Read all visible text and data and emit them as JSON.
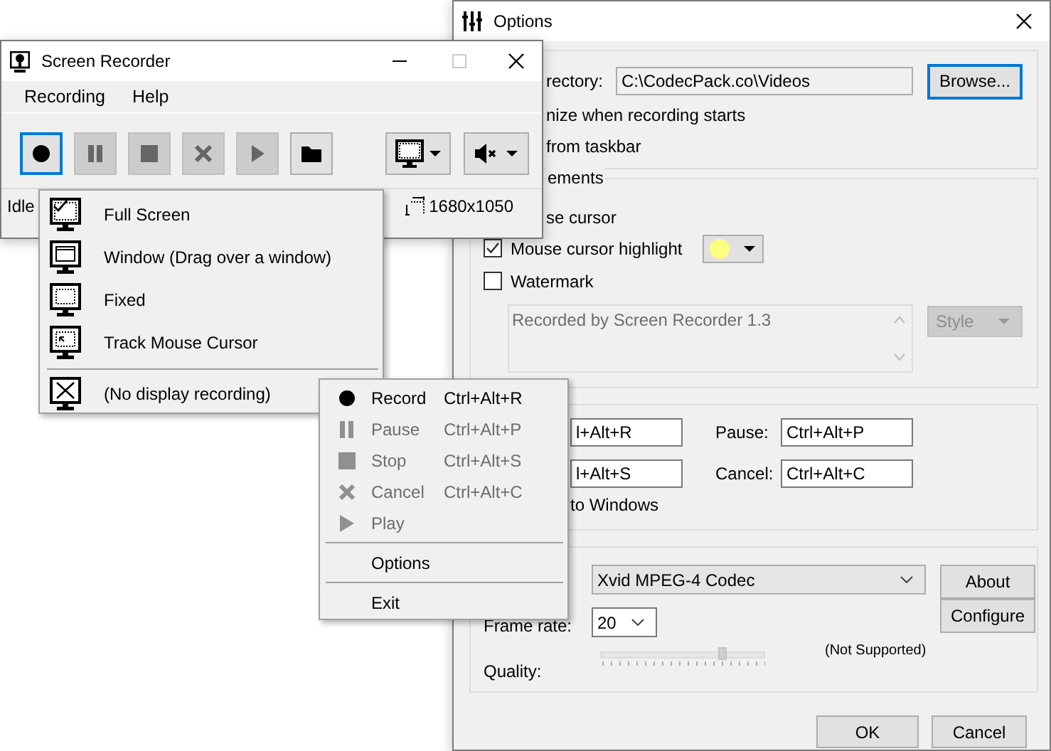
{
  "options_window": {
    "title": "Options",
    "general": {
      "directory_label": "rectory:",
      "directory": "C:\\CodecPack.co\\Videos",
      "browse": "Browse...",
      "lines": [
        "nize when recording starts",
        "from taskbar"
      ]
    },
    "elements": {
      "title": "ements",
      "cursor_label": "se cursor",
      "checks": [
        {
          "label": "Mouse cursor highlight",
          "checked": true
        },
        {
          "label": "Watermark",
          "checked": false
        }
      ],
      "watermark_text": "Recorded by Screen Recorder 1.3",
      "style": "Style"
    },
    "hotkeys": {
      "rows": [
        {
          "value": "l+Alt+R",
          "label": "Pause:",
          "value_2": "Ctrl+Alt+P"
        },
        {
          "value": "l+Alt+S",
          "label": "Cancel:",
          "value_2": "Ctrl+Alt+C"
        }
      ],
      "note": "to Windows"
    },
    "codec": {
      "codec": "Xvid MPEG-4 Codec",
      "about": "About",
      "frame_rate_label": "Frame rate:",
      "frame_rate": "20",
      "configure": "Configure",
      "quality_label": "Quality:",
      "quality": {
        "level": 0.74
      },
      "quality_note": "(Not Supported)"
    },
    "buttons": [
      "OK",
      "Cancel"
    ]
  },
  "recorder": {
    "title": "Screen Recorder",
    "menu": [
      "Recording",
      "Help"
    ],
    "toolbar": [
      {
        "kind": "record",
        "disabled": false,
        "focused": true
      },
      {
        "kind": "pause",
        "disabled": true,
        "focused": false
      },
      {
        "kind": "stop",
        "disabled": true,
        "focused": false
      },
      {
        "kind": "cancel",
        "disabled": true,
        "focused": false
      },
      {
        "kind": "play",
        "disabled": true,
        "focused": false
      },
      {
        "kind": "folder",
        "disabled": false,
        "focused": false
      }
    ],
    "status": "Idle",
    "resolution": "1680x1050"
  },
  "display_menu": [
    {
      "kind": "full",
      "label": "Full Screen",
      "checked": true
    },
    {
      "kind": "window",
      "label": "Window (Drag over a window)",
      "checked": false
    },
    {
      "kind": "fixed",
      "label": "Fixed",
      "checked": false
    },
    {
      "kind": "track",
      "label": "Track Mouse Cursor",
      "checked": false
    },
    {
      "kind": "separator"
    },
    {
      "kind": "none",
      "label": "(No display recording)",
      "checked": false
    }
  ],
  "context_menu": [
    {
      "kind": "record",
      "label": "Record",
      "shortcut": "Ctrl+Alt+R",
      "disabled": false
    },
    {
      "kind": "pause",
      "label": "Pause",
      "shortcut": "Ctrl+Alt+P",
      "disabled": true
    },
    {
      "kind": "stop",
      "label": "Stop",
      "shortcut": "Ctrl+Alt+S",
      "disabled": true
    },
    {
      "kind": "cancel",
      "label": "Cancel",
      "shortcut": "Ctrl+Alt+C",
      "disabled": true
    },
    {
      "kind": "play",
      "label": "Play",
      "disabled": true
    },
    {
      "kind": "separator"
    },
    {
      "kind": "plain",
      "label": "Options",
      "disabled": false
    },
    {
      "kind": "separator"
    },
    {
      "kind": "plain",
      "label": "Exit",
      "disabled": false
    }
  ]
}
